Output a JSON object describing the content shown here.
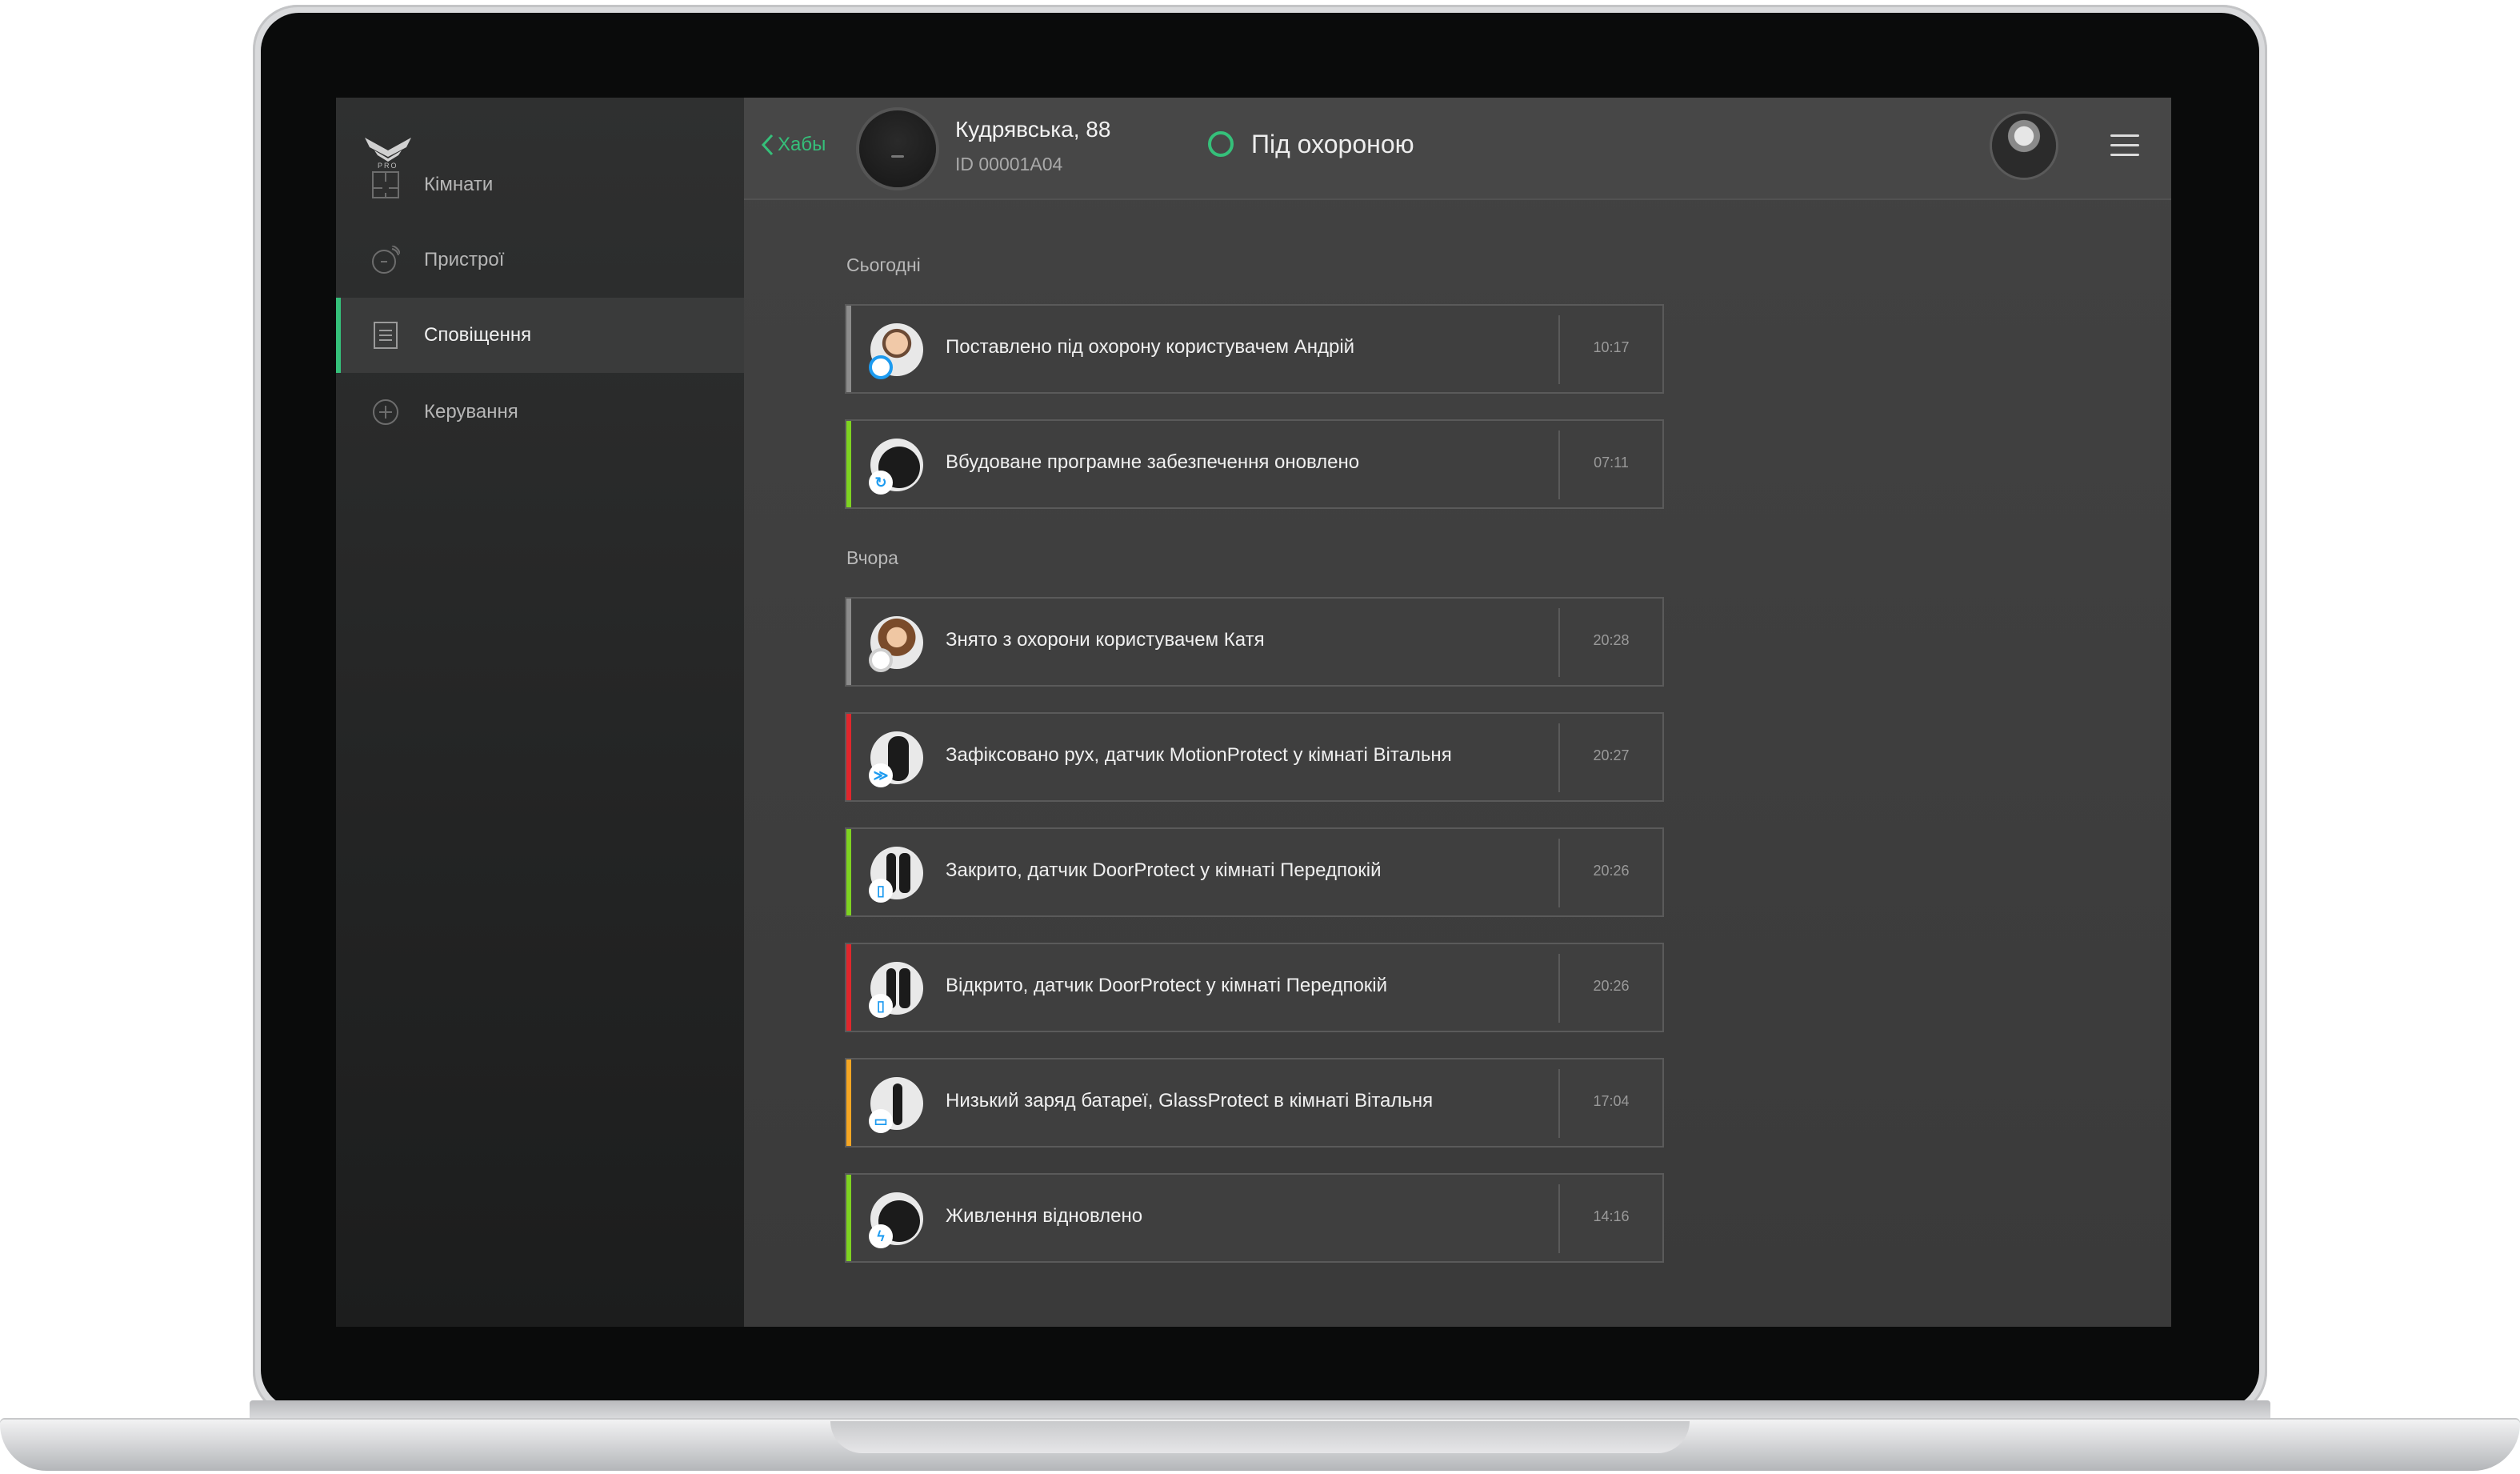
{
  "sidebar": {
    "logo_sub": "PRO",
    "items": [
      {
        "label": "Кімнати",
        "icon": "rooms-icon",
        "active": false
      },
      {
        "label": "Пристрої",
        "icon": "devices-icon",
        "active": false
      },
      {
        "label": "Сповіщення",
        "icon": "notifications-icon",
        "active": true
      },
      {
        "label": "Керування",
        "icon": "control-icon",
        "active": false
      }
    ]
  },
  "header": {
    "back_label": "Хабы",
    "hub_name": "Кудрявська, 88",
    "hub_id": "ID 00001A04",
    "status": "Під охороною",
    "accent": "#35c07a"
  },
  "sections": [
    {
      "title": "Сьогодні",
      "events": [
        {
          "text": "Поставлено під охорону користувачем Андрій",
          "time": "10:17",
          "color": "#8c8c8c",
          "icon": "user-avatar"
        },
        {
          "text": "Вбудоване програмне забезпечення оновлено",
          "time": "07:11",
          "color": "#7ed321",
          "icon": "hub-update-icon"
        }
      ]
    },
    {
      "title": "Вчора",
      "events": [
        {
          "text": "Знято з охорони користувачем Катя",
          "time": "20:28",
          "color": "#8c8c8c",
          "icon": "user-avatar"
        },
        {
          "text": "Зафіксовано рух, датчик MotionProtect у кімнаті Вітальня",
          "time": "20:27",
          "color": "#e0262c",
          "icon": "motion-sensor-icon"
        },
        {
          "text": "Закрито, датчик DoorProtect у кімнаті Передпокій",
          "time": "20:26",
          "color": "#7ed321",
          "icon": "door-sensor-icon"
        },
        {
          "text": "Відкрито, датчик DoorProtect у кімнаті Передпокій",
          "time": "20:26",
          "color": "#e0262c",
          "icon": "door-sensor-icon"
        },
        {
          "text": "Низький заряд батареї, GlassProtect в кімнаті Вітальня",
          "time": "17:04",
          "color": "#f5a623",
          "icon": "glass-sensor-icon"
        },
        {
          "text": "Живлення відновлено",
          "time": "14:16",
          "color": "#7ed321",
          "icon": "hub-power-icon"
        }
      ]
    }
  ]
}
